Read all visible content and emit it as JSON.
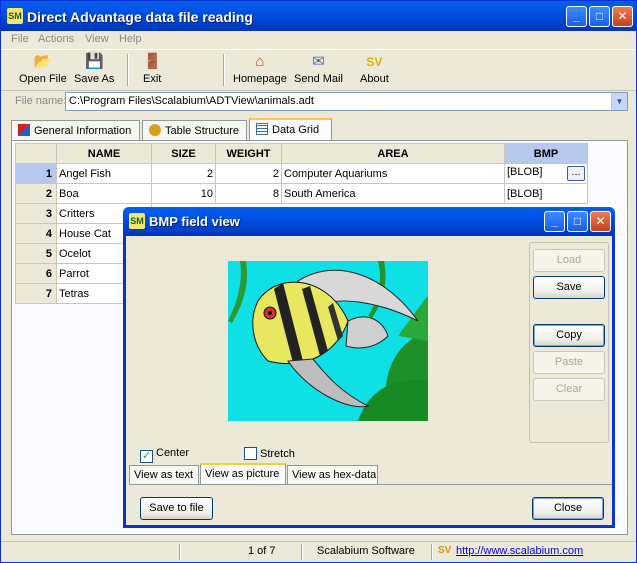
{
  "window": {
    "title": "Direct Advantage data file reading",
    "icon_text": "SM",
    "minimize": "_",
    "maximize": "□",
    "close": "✕"
  },
  "menu": [
    "File",
    "Actions",
    "View",
    "Help"
  ],
  "toolbar": [
    {
      "label": "Open File",
      "icon": "open-folder-icon"
    },
    {
      "label": "Save As",
      "icon": "floppy-disk-icon"
    },
    {
      "label": "Exit",
      "icon": "exit-door-icon"
    },
    {
      "label": "Homepage",
      "icon": "home-icon"
    },
    {
      "label": "Send Mail",
      "icon": "envelope-icon"
    },
    {
      "label": "About",
      "icon": "about-icon"
    }
  ],
  "file": {
    "label": "File name:",
    "value": "C:\\Program Files\\Scalabium\\ADTView\\animals.adt"
  },
  "tabs": [
    "General Information",
    "Table Structure",
    "Data Grid"
  ],
  "active_tab": "Data Grid",
  "grid": {
    "columns": [
      "NAME",
      "SIZE",
      "WEIGHT",
      "AREA",
      "BMP"
    ],
    "rows": [
      {
        "n": "1",
        "name": "Angel Fish",
        "size": "2",
        "weight": "2",
        "area": "Computer Aquariums",
        "bmp": "[BLOB]"
      },
      {
        "n": "2",
        "name": "Boa",
        "size": "10",
        "weight": "8",
        "area": "South America",
        "bmp": "[BLOB]"
      },
      {
        "n": "3",
        "name": "Critters"
      },
      {
        "n": "4",
        "name": "House Cat"
      },
      {
        "n": "5",
        "name": "Ocelot"
      },
      {
        "n": "6",
        "name": "Parrot"
      },
      {
        "n": "7",
        "name": "Tetras"
      }
    ],
    "ellipsis_label": "..."
  },
  "dialog": {
    "title": "BMP field view",
    "buttons": {
      "load": "Load",
      "save": "Save",
      "copy": "Copy",
      "paste": "Paste",
      "clear": "Clear",
      "save_to_file": "Save to file",
      "close": "Close"
    },
    "center_label": "Center",
    "center_checked": true,
    "stretch_label": "Stretch",
    "stretch_checked": false,
    "view_tabs": [
      "View as text",
      "View as picture",
      "View as hex-data"
    ],
    "active_view_tab": "View as picture"
  },
  "status": {
    "record": "1 of 7",
    "company": "Scalabium Software",
    "url": "http://www.scalabium.com"
  },
  "colors": {
    "titlebar": "#0054e3",
    "aqua": "#0fe0e6",
    "active_tab_accent": "#ffc83c"
  }
}
